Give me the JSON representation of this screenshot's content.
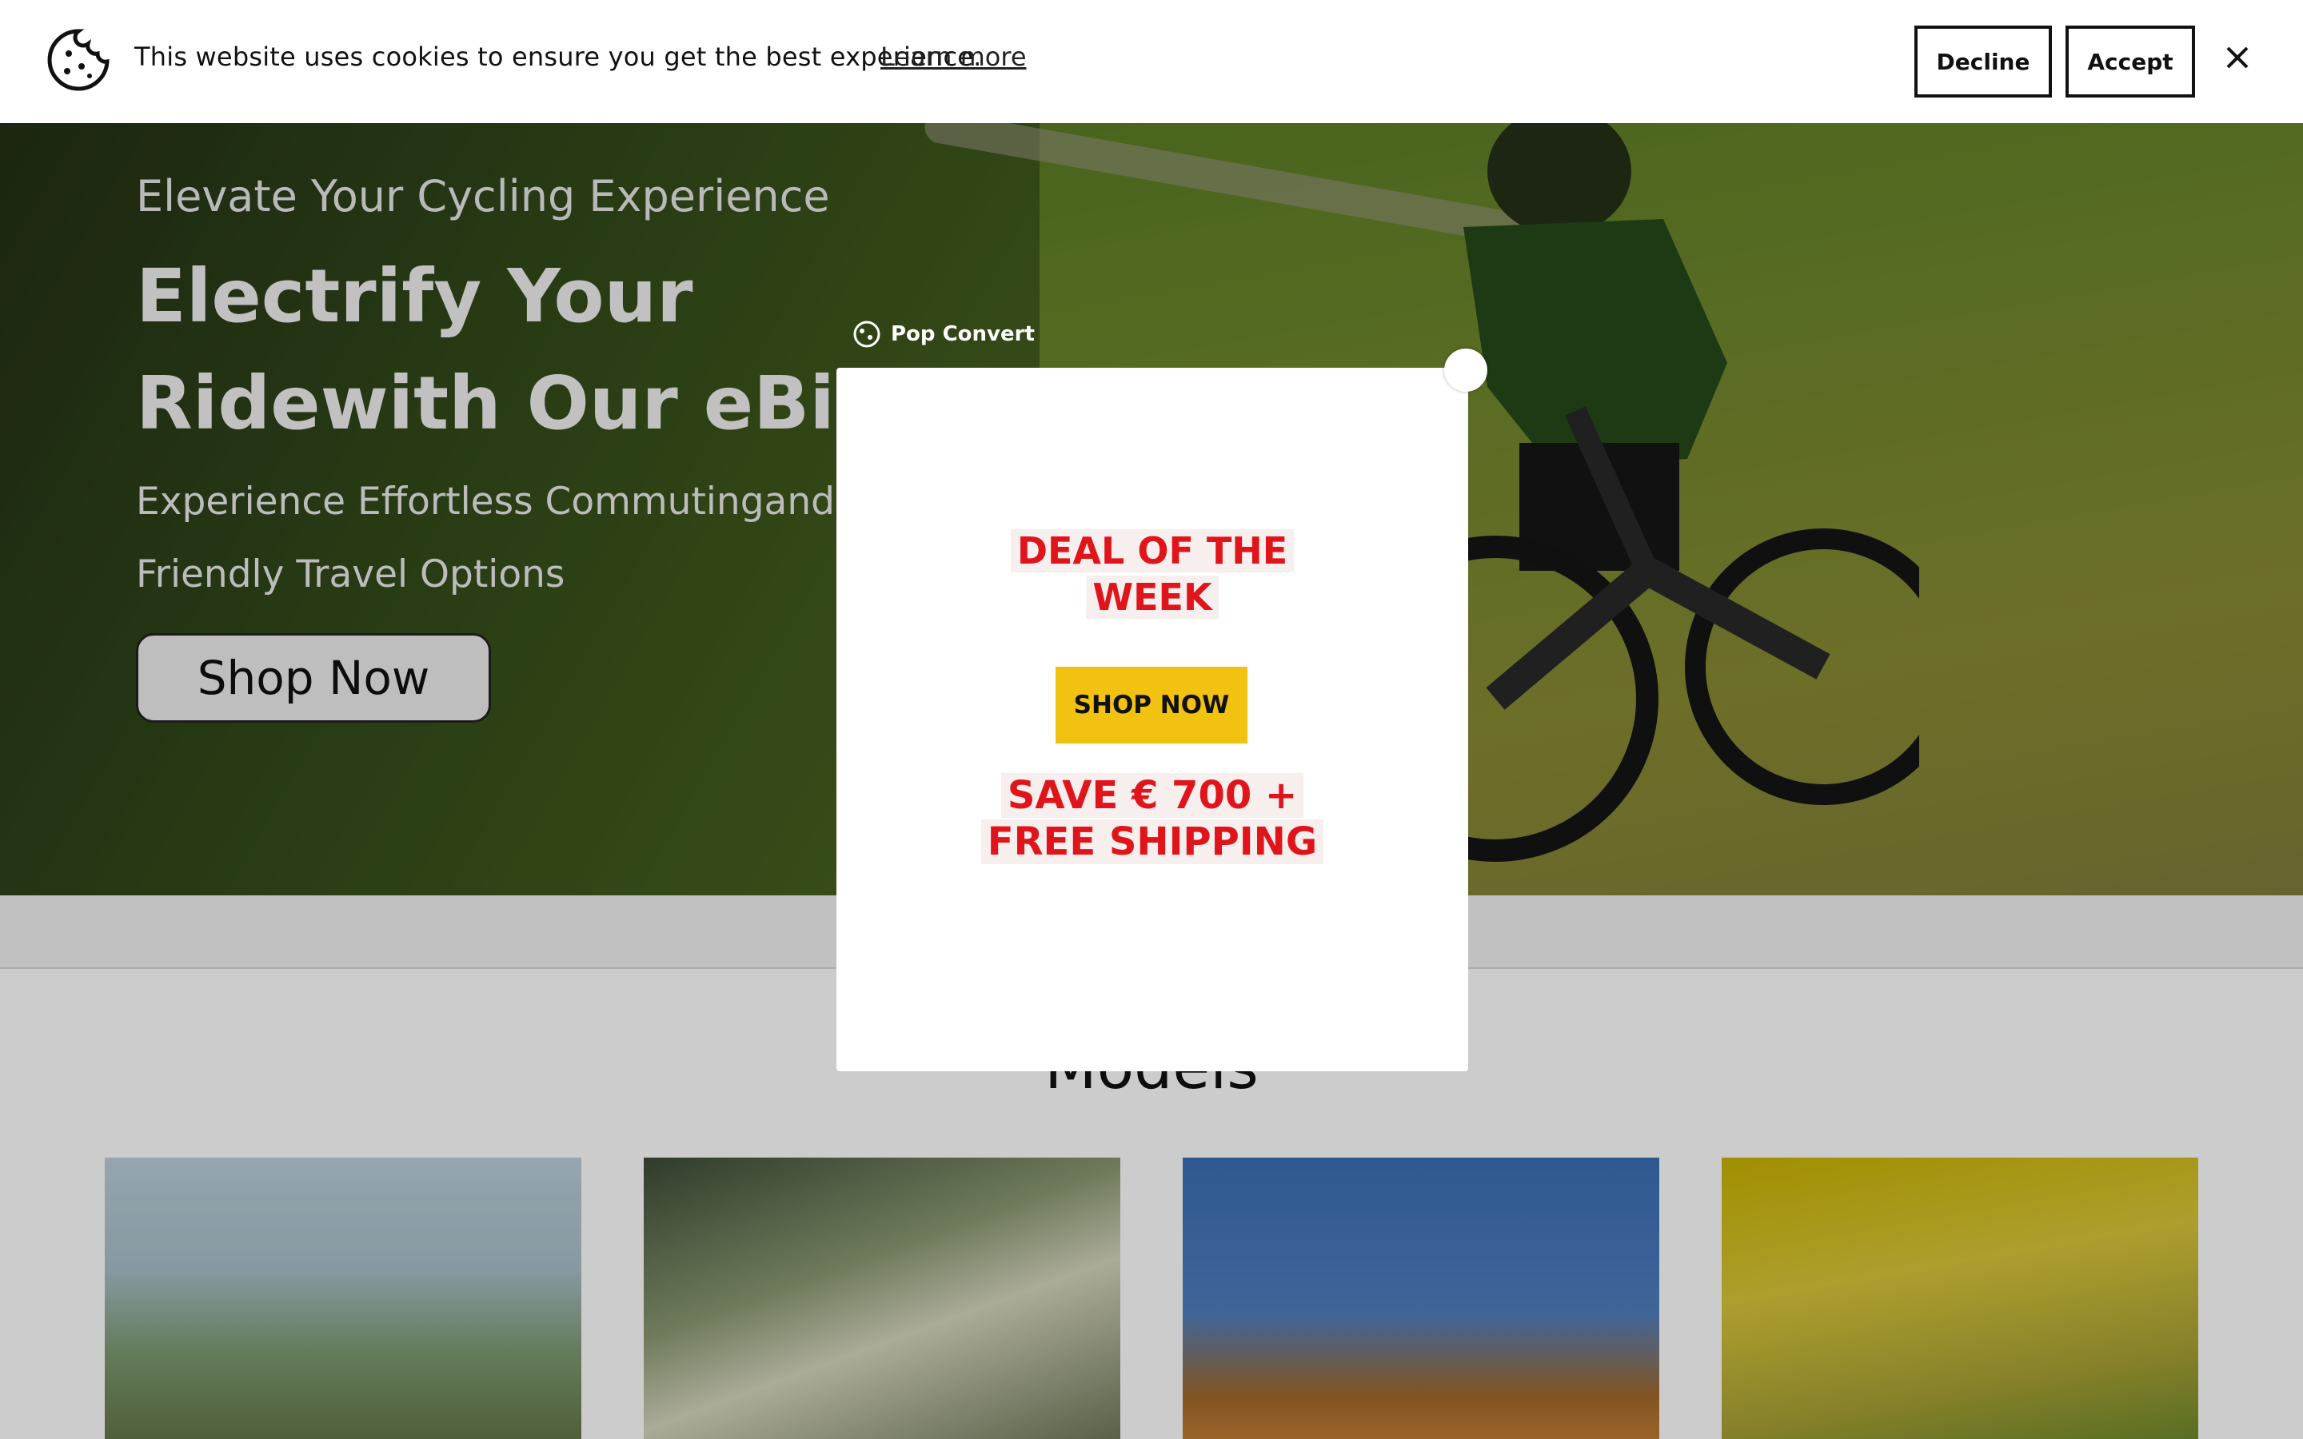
{
  "cookie": {
    "message": "This website uses cookies to ensure you get the best experience.",
    "learn_more": "Learn more",
    "decline": "Decline",
    "accept": "Accept",
    "icon": "cookie-icon",
    "close_icon": "close-icon"
  },
  "hero": {
    "subtitle": "Elevate Your Cycling Experience",
    "title_line1": "Electrify Your",
    "title_line2": "Ridewith Our eBikes",
    "desc_line1": "Experience Effortless Commutingand Eco",
    "desc_line2": "Friendly Travel Options",
    "button": "Shop Now"
  },
  "models": {
    "title": "Models"
  },
  "popup": {
    "brand": "Pop Convert",
    "deal_line1": "DEAL OF THE",
    "deal_line2": "WEEK",
    "shop_button": "SHOP NOW",
    "save_line1": "SAVE € 700 +",
    "save_line2": "FREE SHIPPING",
    "close_icon": "close-icon",
    "colors": {
      "red": "#e0141b",
      "yellow": "#f2c210"
    }
  }
}
